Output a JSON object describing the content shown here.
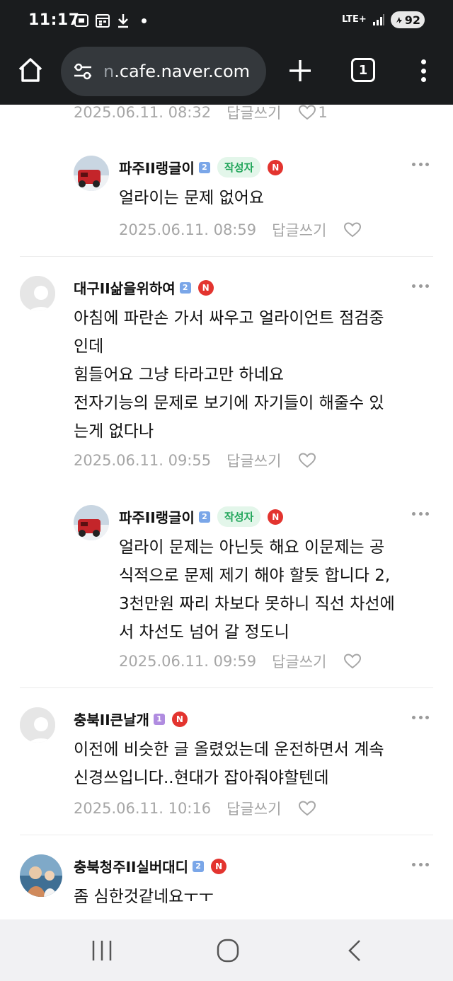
{
  "status_bar": {
    "time": "11:17",
    "network": "LTE+",
    "battery": "92",
    "icons": [
      "screenshot-icon",
      "calendar-icon",
      "download-icon",
      "notification-dot-icon",
      "signal-icon",
      "battery-icon"
    ]
  },
  "browser": {
    "url_prefix": "n",
    "url_main": ".cafe.naver.com",
    "tab_count": "1",
    "icons": [
      "home-icon",
      "site-settings-icon",
      "new-tab-plus-icon",
      "tabs-icon",
      "overflow-menu-icon"
    ]
  },
  "labels": {
    "reply": "답글쓰기",
    "author": "작성자",
    "new_badge": "N"
  },
  "top_meta": {
    "date": "2025.06.11. 08:32",
    "likes": "1"
  },
  "comments": [
    {
      "nickname": "파주II랭글이",
      "level": "2",
      "is_author": true,
      "text_lines": [
        "얼라이는 문제 없어요"
      ],
      "date": "2025.06.11. 08:59"
    },
    {
      "nickname": "대구II삶을위하여",
      "level": "2",
      "is_author": false,
      "text_lines": [
        "아침에 파란손 가서 싸우고 얼라이언트 점검중",
        "인데",
        "힘들어요 그냥 타라고만 하네요",
        "전자기능의 문제로 보기에 자기들이 해줄수 있",
        "는게 없다나"
      ],
      "date": "2025.06.11. 09:55"
    },
    {
      "nickname": "파주II랭글이",
      "level": "2",
      "is_author": true,
      "text_lines": [
        "얼라이 문제는 아닌듯 해요 이문제는 공",
        "식적으로 문제 제기 해야 할듯 합니다 2,",
        "3천만원 짜리 차보다 못하니 직선 차선에",
        "서 차선도 넘어 갈 정도니"
      ],
      "date": "2025.06.11. 09:59"
    },
    {
      "nickname": "충북II큰날개",
      "level": "1",
      "is_author": false,
      "text_lines": [
        "이전에 비슷한 글 올렸었는데 운전하면서 계속",
        "신경쓰입니다..현대가 잡아줘야할텐데"
      ],
      "date": "2025.06.11. 10:16"
    },
    {
      "nickname": "충북청주II실버대디",
      "level": "2",
      "is_author": false,
      "text_lines": [
        "좀 심한것같네요ㅜㅜ"
      ],
      "date": ""
    }
  ],
  "nav_bar": {
    "icons": [
      "recent-apps-icon",
      "home-circle-icon",
      "back-icon"
    ]
  },
  "colors": {
    "chrome_bg": "#1a1c1e",
    "url_pill": "#34383c",
    "meta_gray": "#a6a6a6",
    "author_badge_bg": "#e3f6ea",
    "author_badge_text": "#21a55a",
    "new_badge": "#e3342f",
    "level_blue": "#7aa6e8",
    "level_purple": "#b08ce0"
  }
}
